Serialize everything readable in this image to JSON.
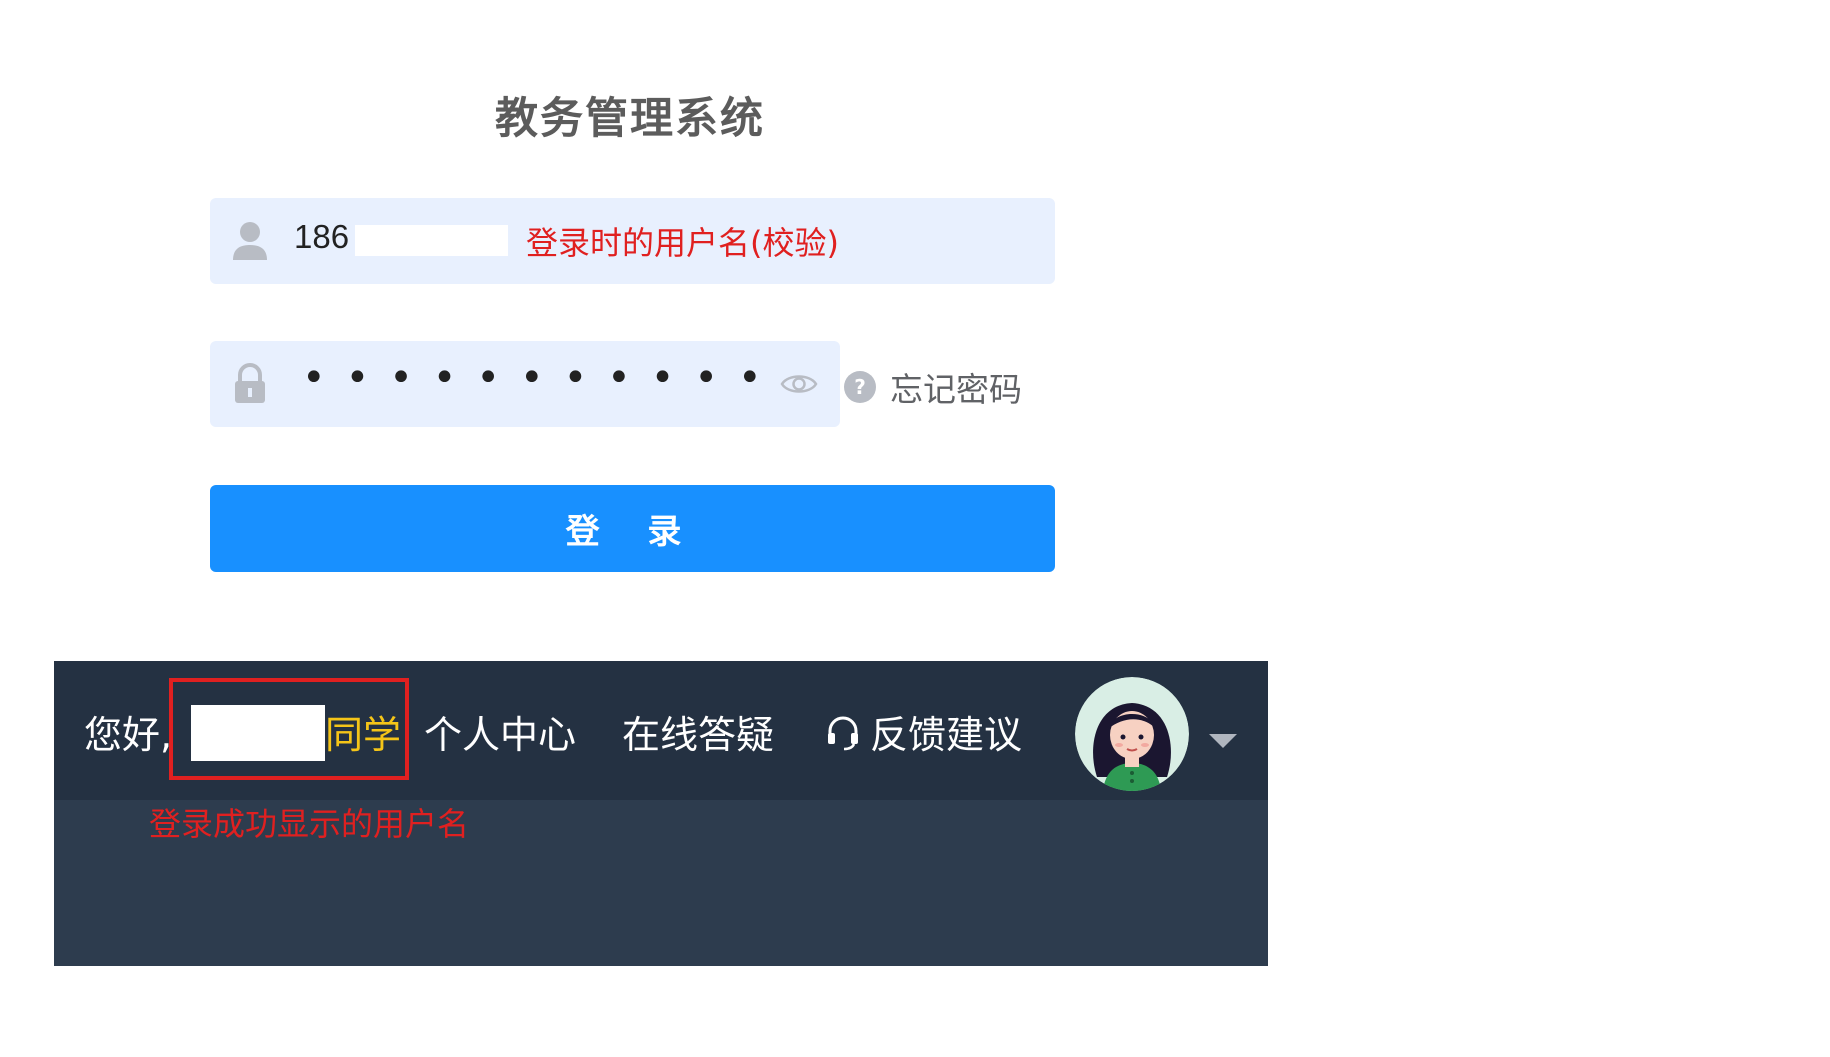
{
  "login": {
    "title": "教务管理系统",
    "username_value": "186",
    "username_note": "登录时的用户名(校验)",
    "password_dots": "•••••••••••",
    "forgot_password": "忘记密码",
    "login_button": "登 录"
  },
  "navbar": {
    "greeting": "您好,",
    "user_suffix": "同学",
    "personal_center": "个人中心",
    "online_qa": "在线答疑",
    "feedback": "反馈建议",
    "success_note": "登录成功显示的用户名"
  },
  "colors": {
    "accent": "#1890ff",
    "field_bg": "#e8f0fe",
    "navbar_bg": "#243142",
    "highlight": "#e02020",
    "username_suffix": "#f5c518"
  }
}
